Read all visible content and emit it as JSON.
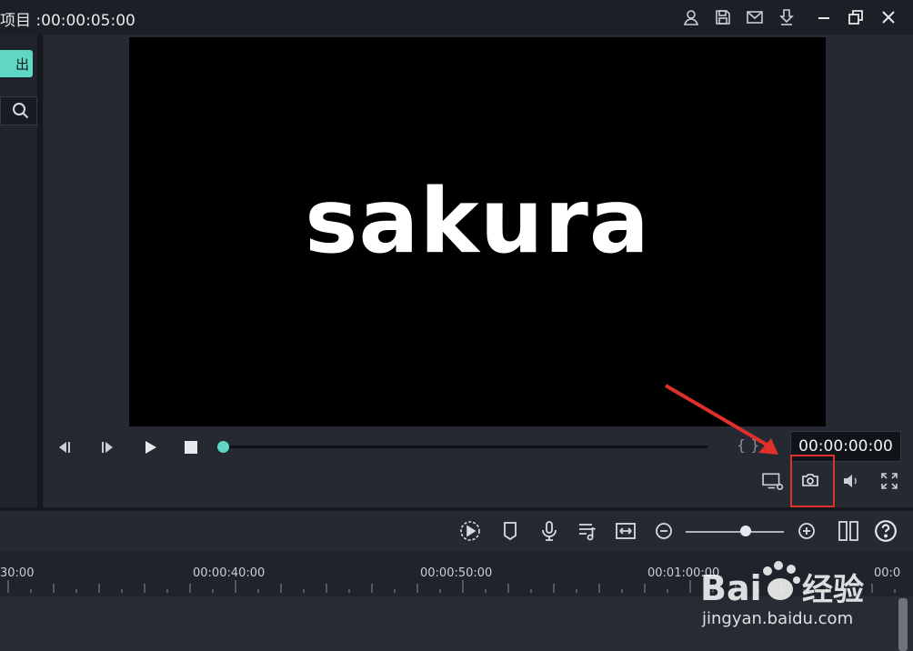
{
  "titlebar": {
    "title": "项目 :00:00:05:00",
    "icons": [
      "account-icon",
      "save-icon",
      "mail-icon",
      "download-icon",
      "minimize-icon",
      "restore-icon",
      "close-icon"
    ]
  },
  "left_panel": {
    "import_label": "出",
    "search_icon": "search-icon"
  },
  "preview": {
    "text": "sakura"
  },
  "playback": {
    "timecode": "00:00:00:00",
    "controls": [
      "prev-frame-icon",
      "next-frame-icon",
      "play-icon",
      "stop-icon"
    ],
    "progress": 0.0,
    "markers": "{ }"
  },
  "preview_tools": [
    "display-settings-icon",
    "snapshot-icon",
    "volume-icon",
    "fullscreen-icon"
  ],
  "toolbar": {
    "tools": [
      "render-icon",
      "marker-icon",
      "voiceover-icon",
      "audio-mixer-icon",
      "fit-icon",
      "zoom-out-icon",
      "zoom-in-icon",
      "split-view-icon",
      "help-icon"
    ],
    "zoom_level": 0.55
  },
  "ruler": {
    "labels": [
      "30:00",
      "00:00:40:00",
      "00:00:50:00",
      "00:01:00:00",
      "00:0"
    ]
  },
  "watermark": {
    "brand": "Bai 经验",
    "url": "jingyan.baidu.com"
  },
  "colors": {
    "accent": "#5fd7c4",
    "highlight": "#e0302b"
  }
}
